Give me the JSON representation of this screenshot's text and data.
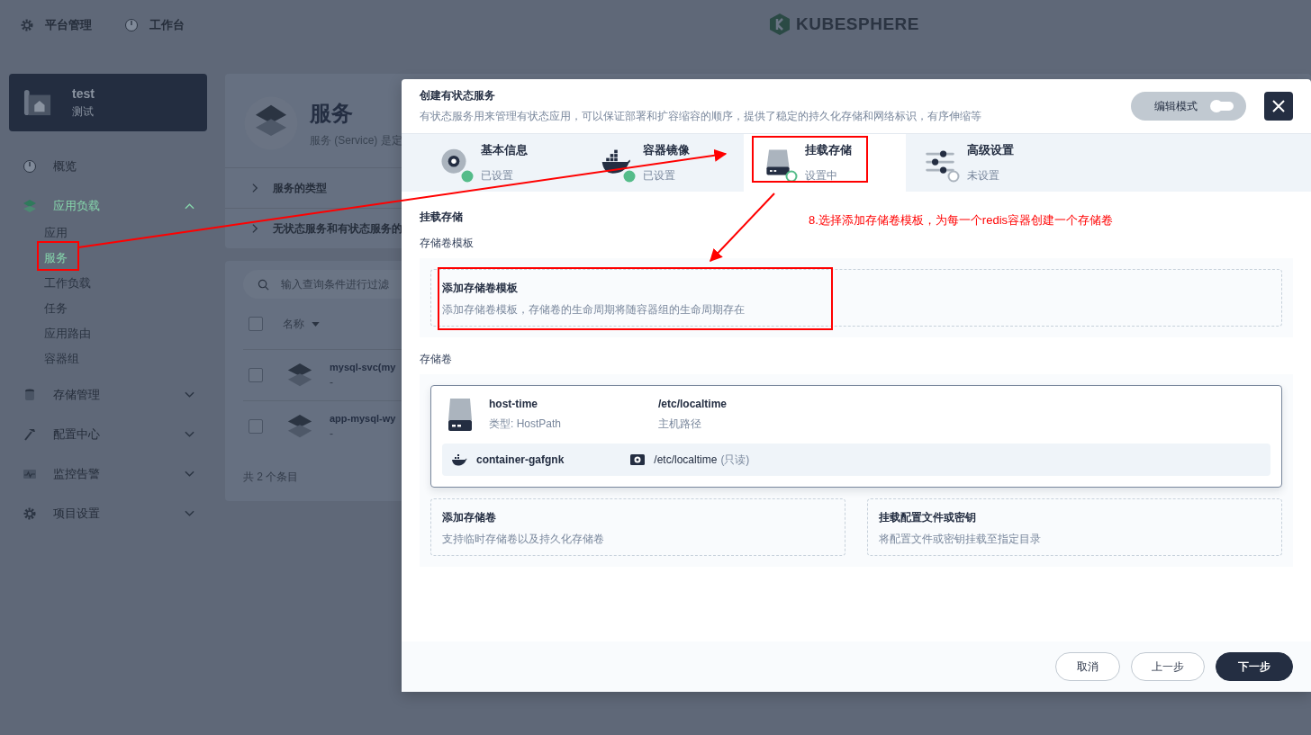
{
  "top_nav": [
    {
      "label": "平台管理",
      "kind": "gear"
    },
    {
      "label": "工作台",
      "kind": "dial"
    }
  ],
  "logo": {
    "text": "KUBESPHERE"
  },
  "project": {
    "name": "test",
    "alias": "测试"
  },
  "sidebar": {
    "items": [
      {
        "label": "概览",
        "kind": "dial",
        "selected": false
      },
      {
        "label": "应用负载",
        "kind": "layers",
        "selected": true,
        "expanded": true,
        "children": [
          {
            "label": "应用",
            "selected": false
          },
          {
            "label": "服务",
            "selected": true
          },
          {
            "label": "工作负载",
            "selected": false
          },
          {
            "label": "任务",
            "selected": false
          },
          {
            "label": "应用路由",
            "selected": false
          },
          {
            "label": "容器组",
            "selected": false
          }
        ]
      },
      {
        "label": "存储管理",
        "kind": "database",
        "selected": false,
        "expanded": false
      },
      {
        "label": "配置中心",
        "kind": "hammer",
        "selected": false,
        "expanded": false
      },
      {
        "label": "监控告警",
        "kind": "monitor",
        "selected": false,
        "expanded": false
      },
      {
        "label": "项目设置",
        "kind": "gear",
        "selected": false,
        "expanded": false
      }
    ]
  },
  "main": {
    "title": "服务",
    "description": "服务 (Service) 是定",
    "sections": [
      {
        "label": "服务的类型",
        "expanded": false
      },
      {
        "label": "无状态服务和有状态服务的",
        "expanded": false
      }
    ],
    "search": {
      "placeholder": "输入查询条件进行过滤"
    },
    "table": {
      "columns": [
        "名称"
      ],
      "rows": [
        {
          "name": "mysql-svc(my",
          "description": "-",
          "checked": false
        },
        {
          "name": "app-mysql-wy",
          "description": "-",
          "checked": false
        }
      ],
      "all_checked": false,
      "footer": "共 2 个条目"
    }
  },
  "modal": {
    "title": "创建有状态服务",
    "description": "有状态服务用来管理有状态应用，可以保证部署和扩容缩容的顺序，提供了稳定的持久化存储和网络标识，有序伸缩等",
    "edit_mode": {
      "label": "编辑模式",
      "on": false
    },
    "steps": [
      {
        "title": "基本信息",
        "status": "已设置",
        "kind": "info",
        "complete": true,
        "selected": false
      },
      {
        "title": "容器镜像",
        "status": "已设置",
        "kind": "image",
        "complete": true,
        "selected": false
      },
      {
        "title": "挂载存储",
        "status": "设置中",
        "kind": "storage",
        "complete": false,
        "selected": true
      },
      {
        "title": "高级设置",
        "status": "未设置",
        "kind": "settings",
        "complete": false,
        "selected": false
      }
    ],
    "heading": "挂载存储",
    "template_label": "存储卷模板",
    "template_card": {
      "title": "添加存储卷模板",
      "description": "添加存储卷模板，存储卷的生命周期将随容器组的生命周期存在"
    },
    "volumes_label": "存储卷",
    "volume": {
      "name": "host-time",
      "type": "类型: HostPath",
      "path": "/etc/localtime",
      "path_label": "主机路径",
      "mount": {
        "container": "container-gafgnk",
        "path": "/etc/localtime",
        "mode": "(只读)"
      }
    },
    "action_cards": [
      {
        "title": "添加存储卷",
        "description": "支持临时存储卷以及持久化存储卷"
      },
      {
        "title": "挂载配置文件或密钥",
        "description": "将配置文件或密钥挂载至指定目录"
      }
    ],
    "buttons": [
      {
        "label": "取消",
        "kind": "default"
      },
      {
        "label": "上一步",
        "kind": "default"
      },
      {
        "label": "下一步",
        "kind": "primary"
      }
    ]
  },
  "annotation": {
    "text": "8.选择添加存储卷模板，为每一个redis容器创建一个存储卷"
  }
}
